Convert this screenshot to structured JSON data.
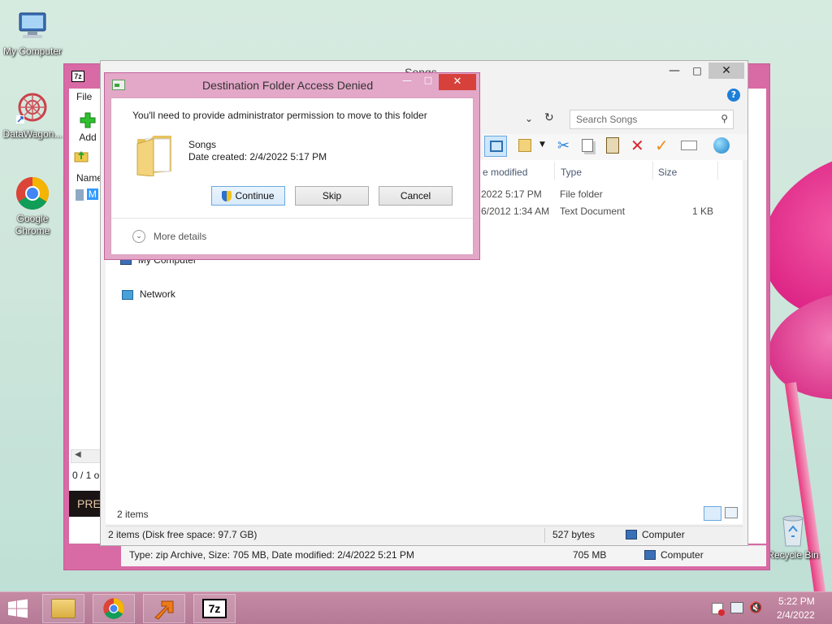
{
  "desktop": {
    "icons": [
      {
        "label": "My Computer",
        "icon": "my-computer-icon"
      },
      {
        "label": "DataWagon...",
        "icon": "datawagon-icon"
      },
      {
        "label": "Google Chrome",
        "icon": "chrome-icon"
      },
      {
        "label": "Recycle Bin",
        "icon": "recycle-bin-icon"
      }
    ]
  },
  "zip_window": {
    "app_icon_text": "7z",
    "menu_file": "File",
    "add_label": "Add",
    "name_header": "Name",
    "selected_item": "M",
    "status_count": "0 / 1 o",
    "banner_text": "PRE",
    "status_info": "Type: zip Archive, Size: 705 MB, Date modified: 2/4/2022 5:21 PM",
    "status_size": "705 MB",
    "status_location": "Computer"
  },
  "explorer": {
    "title": "Songs",
    "search_placeholder": "Search Songs",
    "columns": {
      "date": "e modified",
      "type": "Type",
      "size": "Size"
    },
    "rows": [
      {
        "date": "2022 5:17 PM",
        "type": "File folder",
        "size": ""
      },
      {
        "date": "6/2012 1:34 AM",
        "type": "Text Document",
        "size": "1 KB"
      }
    ],
    "nav": {
      "my_computer": "My Computer",
      "network": "Network"
    },
    "item_count": "2 items",
    "status_left": "2 items (Disk free space: 97.7 GB)",
    "status_bytes": "527 bytes",
    "status_location": "Computer"
  },
  "dialog": {
    "title": "Destination Folder Access Denied",
    "message": "You'll need to provide administrator permission to move to this folder",
    "folder_name": "Songs",
    "folder_date": "Date created: 2/4/2022 5:17 PM",
    "continue_label": "Continue",
    "skip_label": "Skip",
    "cancel_label": "Cancel",
    "more_details": "More details"
  },
  "taskbar": {
    "time": "5:22 PM",
    "date": "2/4/2022",
    "apps": [
      "file-explorer-icon",
      "chrome-icon",
      "arrow-app-icon",
      "7zip-icon"
    ]
  },
  "colors": {
    "accent": "#d56aa0",
    "dialog_title_bg": "#e3a7c8",
    "close_red": "#d7413b",
    "taskbar": "#b97e9a"
  }
}
